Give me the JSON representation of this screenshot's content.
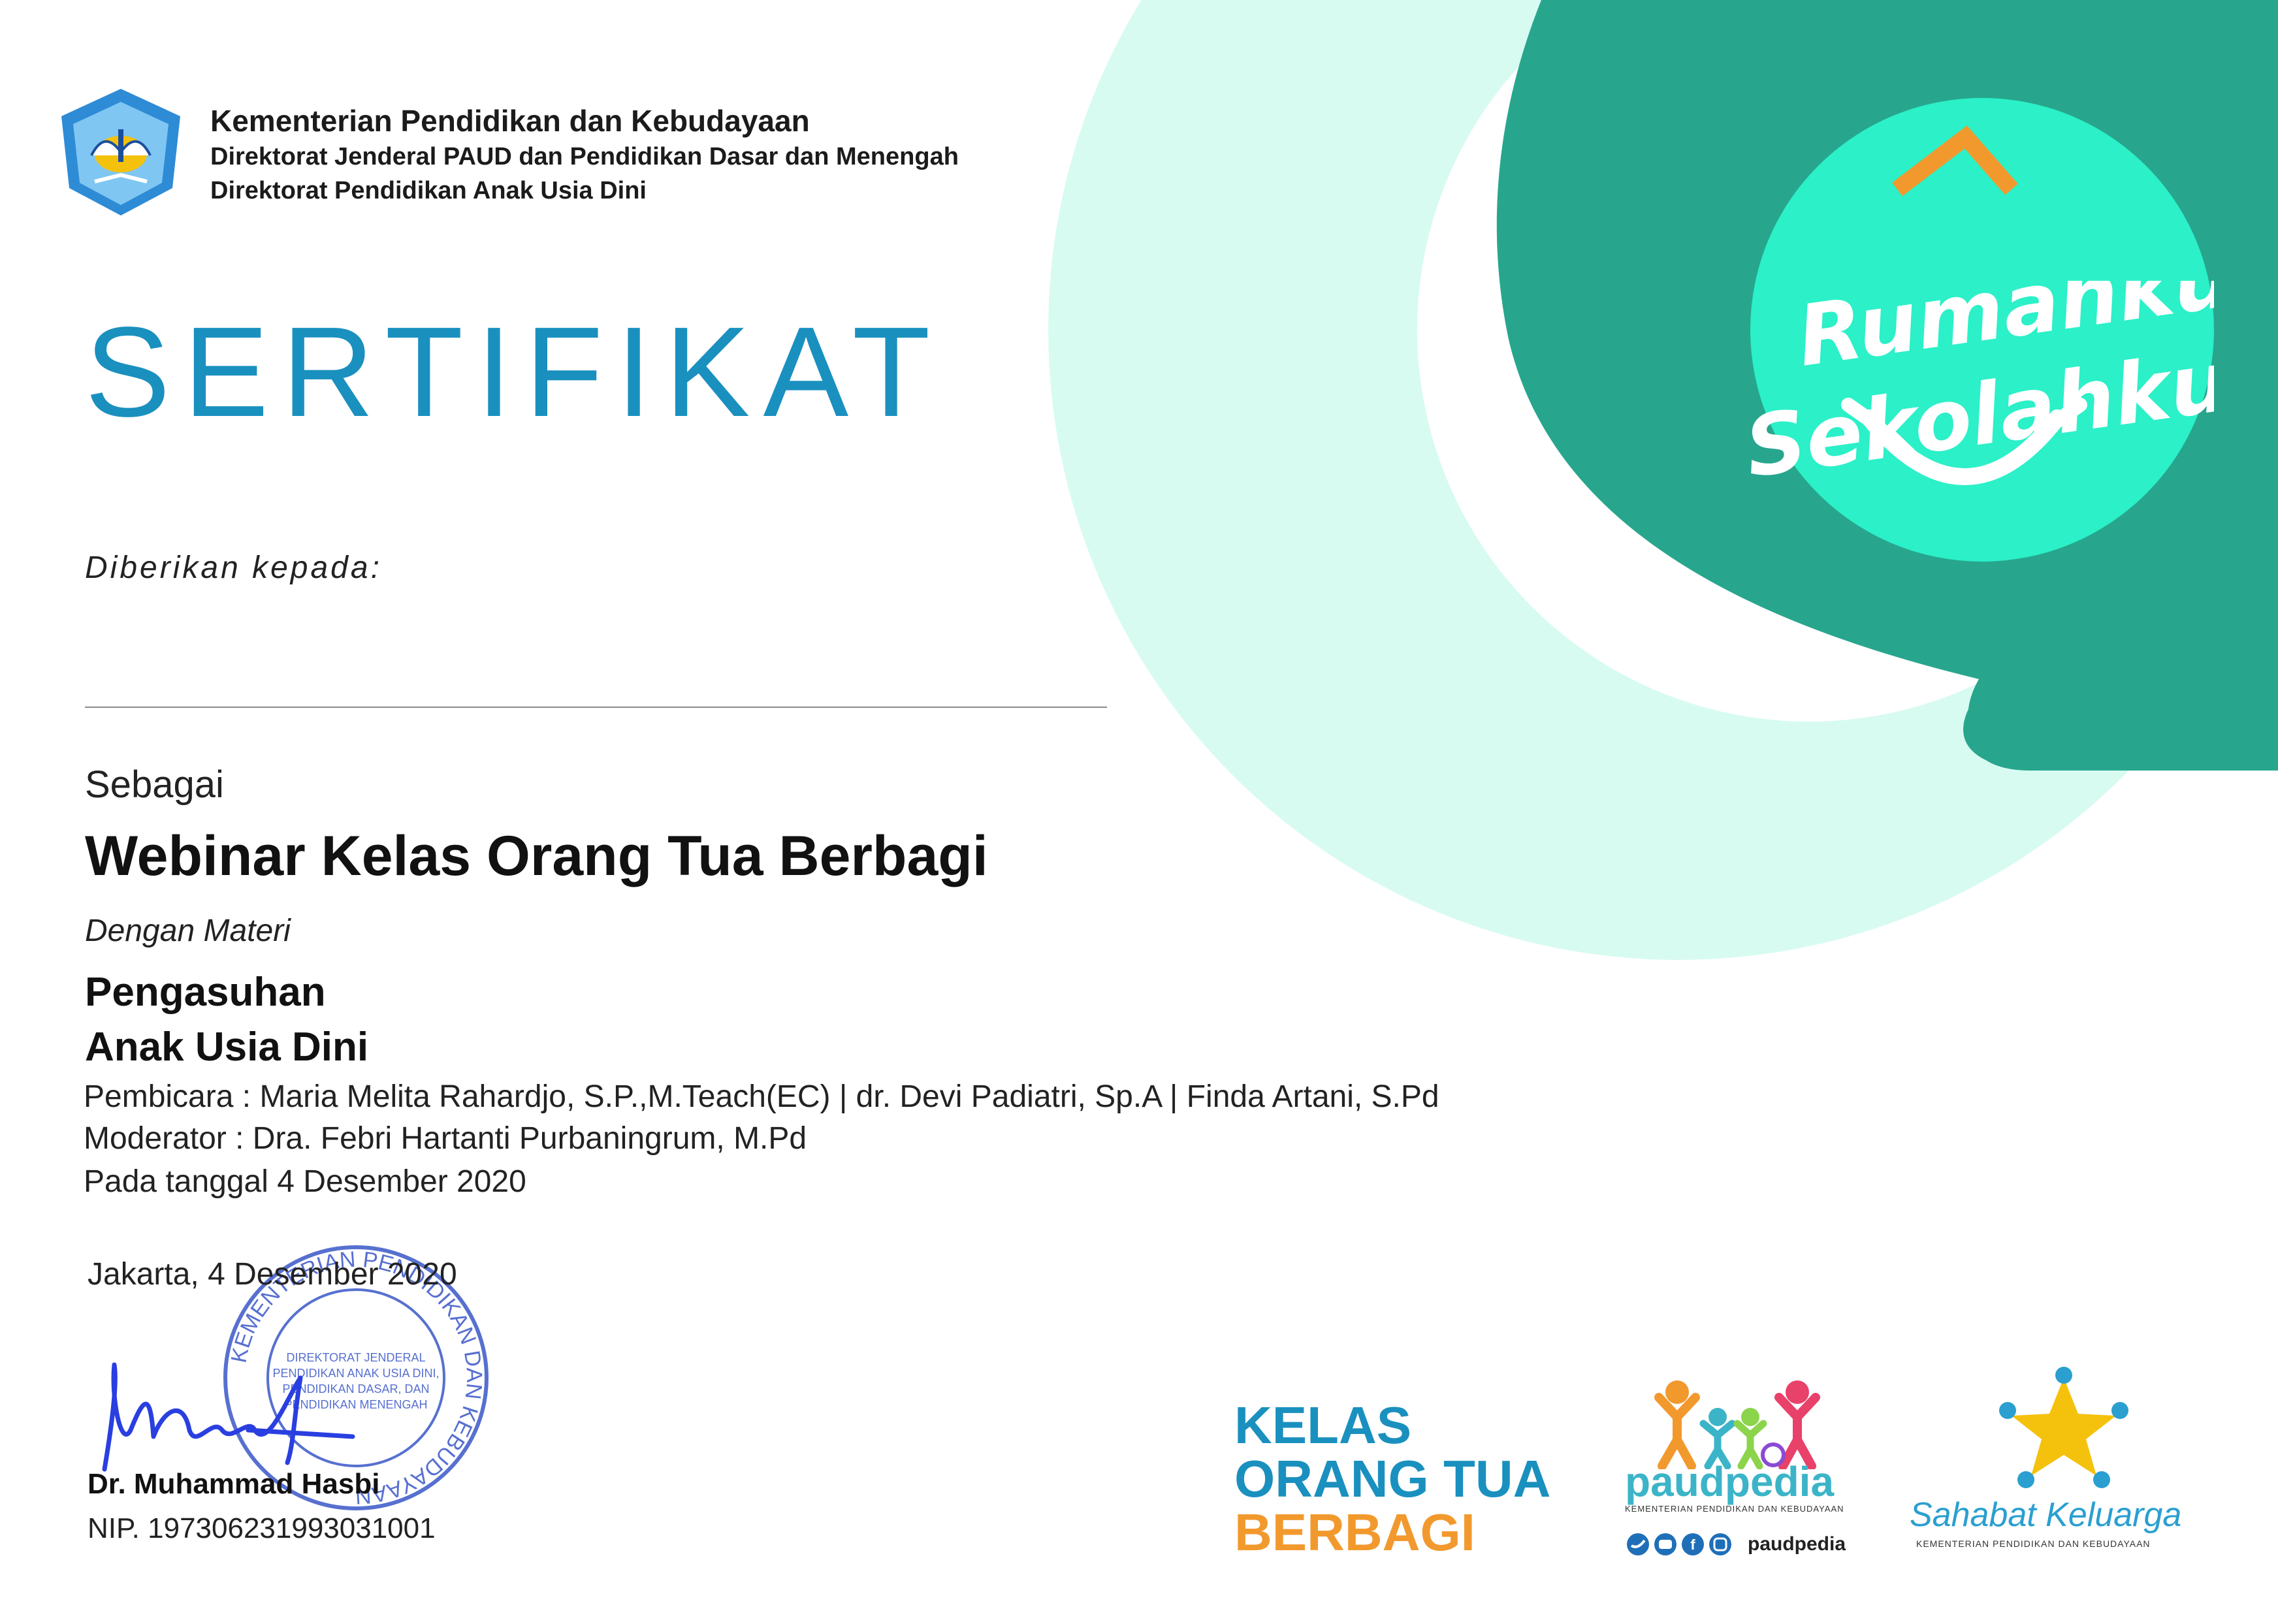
{
  "header": {
    "ministry": "Kementerian Pendidikan dan Kebudayaan",
    "directorate_general": "Direktorat Jenderal PAUD dan Pendidikan Dasar dan Menengah",
    "directorate": "Direktorat Pendidikan Anak Usia Dini",
    "logo_text": "TUT WURI HANDAYANI"
  },
  "certificate": {
    "title": "SERTIFIKAT",
    "given_to": "Diberikan kepada:",
    "as_label": "Sebagai",
    "event": "Webinar Kelas Orang Tua Berbagi",
    "material_label": "Dengan Materi",
    "material_line1": "Pengasuhan",
    "material_line2": "Anak Usia Dini",
    "speakers": "Pembicara : Maria Melita Rahardjo, S.P.,M.Teach(EC) | dr. Devi Padiatri, Sp.A | Finda Artani, S.Pd",
    "moderator": "Moderator : Dra. Febri Hartanti Purbaningrum, M.Pd",
    "date": "Pada tanggal 4 Desember 2020"
  },
  "signature": {
    "place_date": "Jakarta, 4 Desember 2020",
    "name": "Dr. Muhammad Hasbi",
    "nip": "NIP. 197306231993031001",
    "stamp_outer": "KEMENTERIAN PENDIDIKAN DAN KEBUDAYAAN",
    "stamp_inner": [
      "DIREKTORAT JENDERAL",
      "PENDIDIKAN ANAK USIA DINI,",
      "PENDIDIKAN DASAR, DAN",
      "PENDIDIKAN MENENGAH"
    ]
  },
  "branding": {
    "rumahku_line1": "Rumahku",
    "rumahku_line2": "Sekolahku",
    "kob_line1": "KELAS",
    "kob_line2": "ORANG TUA",
    "kob_line3": "BERBAGI",
    "paudpedia": "paudpedia",
    "paudpedia_ministry": "KEMENTERIAN PENDIDIKAN DAN KEBUDAYAAN",
    "paudpedia_handle": "paudpedia",
    "sahabat": "Sahabat Keluarga",
    "sahabat_ministry": "KEMENTERIAN PENDIDIKAN DAN KEBUDAYAAN"
  },
  "colors": {
    "light_mint": "#d8fbf1",
    "teal_dark": "#27a68d",
    "turquoise": "#2bf0c8",
    "title_blue": "#1a90bf",
    "orange": "#f2992e"
  }
}
